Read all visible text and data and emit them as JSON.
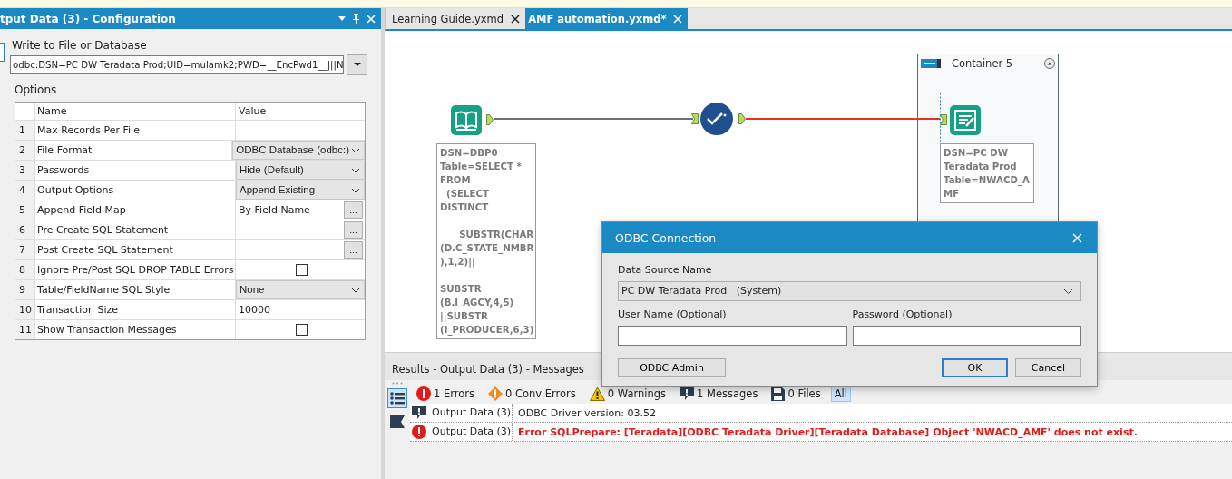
{
  "config_panel": {
    "title": "tput Data (3) - Configuration",
    "write_label": "Write to File or Database",
    "connection_value": "odbc:DSN=PC DW Teradata Prod;UID=mulamk2;PWD=__EncPwd1__|||N",
    "options_label": "Options",
    "columns": [
      "Name",
      "Value"
    ],
    "rows": [
      {
        "number": "1",
        "name": "Max Records Per File",
        "kind": "text"
      },
      {
        "number": "2",
        "name": "File Format",
        "kind": "select",
        "value": "ODBC Database (odbc:)"
      },
      {
        "number": "3",
        "name": "Passwords",
        "kind": "select",
        "value": "Hide (Default)"
      },
      {
        "number": "4",
        "name": "Output Options",
        "kind": "select",
        "value": "Append Existing"
      },
      {
        "number": "5",
        "name": "Append Field Map",
        "kind": "ellipsis",
        "value": "By Field Name",
        "button": "..."
      },
      {
        "number": "6",
        "name": "Pre Create SQL Statement",
        "kind": "ellipsis",
        "button": "..."
      },
      {
        "number": "7",
        "name": "Post Create SQL Statement",
        "kind": "ellipsis",
        "button": "..."
      },
      {
        "number": "8",
        "name": "Ignore Pre/Post SQL DROP TABLE Errors",
        "kind": "checkbox",
        "checked": false
      },
      {
        "number": "9",
        "name": "Table/FieldName SQL Style",
        "kind": "select",
        "value": "None"
      },
      {
        "number": "10",
        "name": "Transaction Size",
        "kind": "text",
        "value": "10000"
      },
      {
        "number": "11",
        "name": "Show Transaction Messages",
        "kind": "checkbox",
        "checked": false
      }
    ]
  },
  "tabs": [
    {
      "label": "Learning Guide.yxmd",
      "selected": false
    },
    {
      "label": "AMF automation.yxmd*",
      "selected": true
    }
  ],
  "canvas": {
    "nodes": [
      {
        "kind": "input",
        "selected": false,
        "annotation": "DSN=DBP0\nTable=SELECT *\nFROM\n  (SELECT\nDISTINCT\n\n      SUBSTR(CHAR\n(D.C_STATE_NMBR\n),1,2)||\n\nSUBSTR\n(B.I_AGCY,4,5)\n||SUBSTR\n(I_PRODUCER,6,3)"
      },
      {
        "kind": "browse",
        "selected": false
      },
      {
        "kind": "output",
        "selected": true,
        "annotation": "DSN=PC DW\nTeradata Prod\nTable=NWACD_A\nMF"
      }
    ],
    "connections": [
      {
        "color": "#707070"
      },
      {
        "color": "#e8302a"
      }
    ],
    "container": {
      "title": "Container 5"
    }
  },
  "results": {
    "title": "Results - Output Data (3) - Messages",
    "side_tools": [
      {
        "kind": "list",
        "selected": true
      },
      {
        "kind": "flag",
        "selected": false
      }
    ],
    "filters": [
      {
        "kind": "error",
        "label": "1 Errors",
        "selected": false
      },
      {
        "kind": "conv-error",
        "label": "0 Conv Errors",
        "selected": false
      },
      {
        "kind": "warning",
        "label": "0 Warnings",
        "selected": false
      },
      {
        "kind": "message",
        "label": "1 Messages",
        "selected": false
      },
      {
        "kind": "file",
        "label": "0 Files",
        "selected": false
      },
      {
        "kind": "all",
        "label": "All",
        "selected": true
      }
    ],
    "messages": [
      {
        "kind": "message",
        "source": "Output Data (3)",
        "text": "ODBC Driver version: 03.52"
      },
      {
        "kind": "error",
        "source": "Output Data (3)",
        "text": "Error SQLPrepare: [Teradata][ODBC Teradata Driver][Teradata Database] Object 'NWACD_AMF' does not exist."
      }
    ]
  },
  "dialog": {
    "title": "ODBC Connection",
    "dsn_label": "Data Source Name",
    "dsn_value": "PC DW Teradata Prod   (System)",
    "user_label": "User Name (Optional)",
    "password_label": "Password (Optional)",
    "buttons": [
      {
        "label": "ODBC Admin",
        "default": false
      },
      {
        "label": "OK",
        "default": true
      },
      {
        "label": "Cancel",
        "default": false
      }
    ]
  }
}
